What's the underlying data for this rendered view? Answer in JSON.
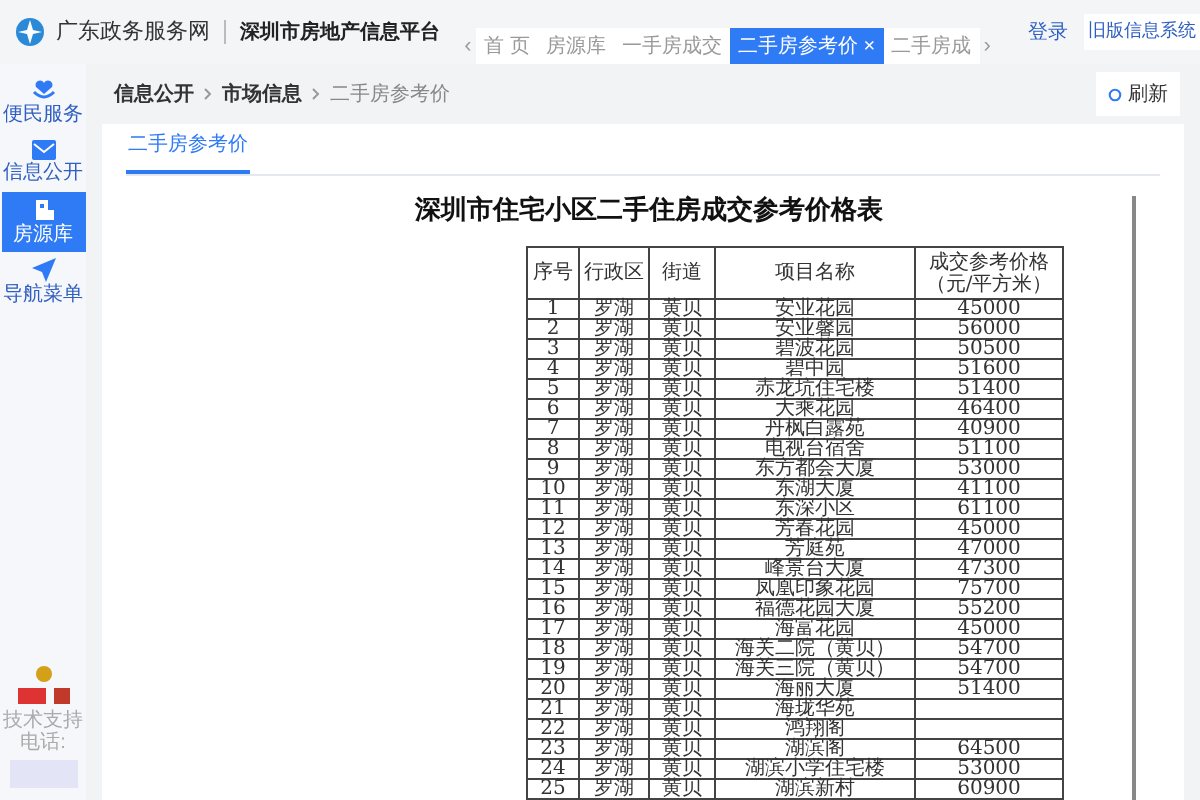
{
  "header": {
    "site_name": "广东政务服务网",
    "platform_name": "深圳市房地产信息平台",
    "tab_prev": "‹",
    "tab_next": "›",
    "login": "登录",
    "old_system": "旧版信息系统"
  },
  "tabs": [
    {
      "label": "首 页",
      "selected": false
    },
    {
      "label": "房源库",
      "selected": false
    },
    {
      "label": "一手房成交",
      "selected": false
    },
    {
      "label": "二手房参考价",
      "selected": true,
      "close": "×"
    },
    {
      "label": "二手房成",
      "selected": false
    }
  ],
  "sidebar": {
    "items": [
      {
        "label": "便民服务",
        "selected": false
      },
      {
        "label": "信息公开",
        "selected": false
      },
      {
        "label": "房源库",
        "selected": true
      },
      {
        "label": "导航菜单",
        "selected": false
      }
    ],
    "support": "技术支持电话:"
  },
  "breadcrumb": [
    "信息公开",
    "市场信息",
    "二手房参考价"
  ],
  "refresh": "刷新",
  "subtab": "二手房参考价",
  "document": {
    "title": "深圳市住宅小区二手住房成交参考价格表",
    "columns": [
      "序号",
      "行政区",
      "街道",
      "项目名称",
      "成交参考价格（元/平方米）"
    ],
    "rows": [
      [
        "1",
        "罗湖",
        "黄贝",
        "安业花园",
        "45000"
      ],
      [
        "2",
        "罗湖",
        "黄贝",
        "安业馨园",
        "56000"
      ],
      [
        "3",
        "罗湖",
        "黄贝",
        "碧波花园",
        "50500"
      ],
      [
        "4",
        "罗湖",
        "黄贝",
        "碧中园",
        "51600"
      ],
      [
        "5",
        "罗湖",
        "黄贝",
        "赤龙坑住宅楼",
        "51400"
      ],
      [
        "6",
        "罗湖",
        "黄贝",
        "大乘花园",
        "46400"
      ],
      [
        "7",
        "罗湖",
        "黄贝",
        "丹枫白露苑",
        "40900"
      ],
      [
        "8",
        "罗湖",
        "黄贝",
        "电视台宿舍",
        "51100"
      ],
      [
        "9",
        "罗湖",
        "黄贝",
        "东方都会大厦",
        "53000"
      ],
      [
        "10",
        "罗湖",
        "黄贝",
        "东湖大厦",
        "41100"
      ],
      [
        "11",
        "罗湖",
        "黄贝",
        "东深小区",
        "61100"
      ],
      [
        "12",
        "罗湖",
        "黄贝",
        "芳春花园",
        "45000"
      ],
      [
        "13",
        "罗湖",
        "黄贝",
        "芳庭苑",
        "47000"
      ],
      [
        "14",
        "罗湖",
        "黄贝",
        "峰景台大厦",
        "47300"
      ],
      [
        "15",
        "罗湖",
        "黄贝",
        "凤凰印象花园",
        "75700"
      ],
      [
        "16",
        "罗湖",
        "黄贝",
        "福德花园大厦",
        "55200"
      ],
      [
        "17",
        "罗湖",
        "黄贝",
        "海富花园",
        "45000"
      ],
      [
        "18",
        "罗湖",
        "黄贝",
        "海关二院（黄贝）",
        "54700"
      ],
      [
        "19",
        "罗湖",
        "黄贝",
        "海关三院（黄贝）",
        "54700"
      ],
      [
        "20",
        "罗湖",
        "黄贝",
        "海丽大厦",
        "51400"
      ],
      [
        "21",
        "罗湖",
        "黄贝",
        "海珑华苑"
      ],
      [
        "22",
        "罗湖",
        "黄贝",
        "鸿翔阁"
      ],
      [
        "23",
        "罗湖",
        "黄贝",
        "湖滨阁",
        "64500"
      ],
      [
        "24",
        "罗湖",
        "黄贝",
        "湖滨小学住宅楼",
        "53000"
      ],
      [
        "25",
        "罗湖",
        "黄贝",
        "湖滨新村",
        "60900"
      ]
    ]
  }
}
